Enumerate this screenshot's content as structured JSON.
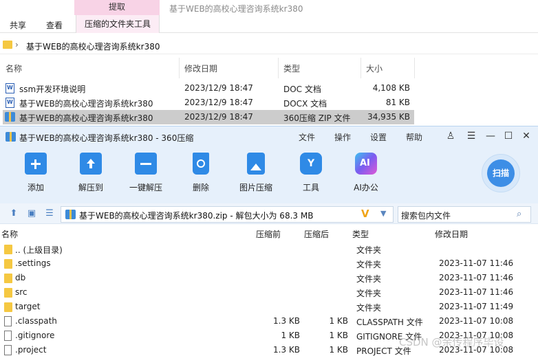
{
  "explorer": {
    "extract_tab": "提取",
    "window_title": "基于WEB的高校心理咨询系统kr380",
    "ribbon_tabs": [
      "共享",
      "查看",
      "压缩的文件夹工具"
    ],
    "address": "基于WEB的高校心理咨询系统kr380",
    "columns": [
      "名称",
      "修改日期",
      "类型",
      "大小"
    ],
    "files": [
      {
        "name": "ssm开发环境说明",
        "date": "2023/12/9 18:47",
        "type": "DOC 文档",
        "size": "4,108 KB",
        "icon": "word-doc-icon"
      },
      {
        "name": "基于WEB的高校心理咨询系统kr380",
        "date": "2023/12/9 18:47",
        "type": "DOCX 文档",
        "size": "81 KB",
        "icon": "word-doc-icon"
      },
      {
        "name": "基于WEB的高校心理咨询系统kr380",
        "date": "2023/12/9 18:47",
        "type": "360压缩 ZIP 文件",
        "size": "34,935 KB",
        "icon": "zip-archive-icon"
      }
    ]
  },
  "zipwin": {
    "title": "基于WEB的高校心理咨询系统kr380 - 360压缩",
    "menu": [
      "文件",
      "操作",
      "设置",
      "帮助"
    ],
    "tools": [
      {
        "label": "添加",
        "color": "#2f8ae6"
      },
      {
        "label": "解压到",
        "color": "#2f8ae6"
      },
      {
        "label": "一键解压",
        "color": "#2f8ae6"
      },
      {
        "label": "删除",
        "color": "#2f8ae6"
      },
      {
        "label": "图片压缩",
        "color": "#2f8ae6"
      },
      {
        "label": "工具",
        "color": "#2f8ae6"
      },
      {
        "label": "AI办公",
        "color": "#7b5cf0"
      }
    ],
    "scan_label": "扫描",
    "path": "基于WEB的高校心理咨询系统kr380.zip - 解包大小为 68.3 MB",
    "search_placeholder": "搜索包内文件",
    "columns": [
      "名称",
      "压缩前",
      "压缩后",
      "类型",
      "修改日期"
    ],
    "rows": [
      {
        "name": ".. (上级目录)",
        "before": "",
        "after": "",
        "type": "文件夹",
        "date": "",
        "kind": "folder"
      },
      {
        "name": ".settings",
        "before": "",
        "after": "",
        "type": "文件夹",
        "date": "2023-11-07 11:46",
        "kind": "folder"
      },
      {
        "name": "db",
        "before": "",
        "after": "",
        "type": "文件夹",
        "date": "2023-11-07 11:46",
        "kind": "folder"
      },
      {
        "name": "src",
        "before": "",
        "after": "",
        "type": "文件夹",
        "date": "2023-11-07 11:46",
        "kind": "folder"
      },
      {
        "name": "target",
        "before": "",
        "after": "",
        "type": "文件夹",
        "date": "2023-11-07 11:49",
        "kind": "folder"
      },
      {
        "name": ".classpath",
        "before": "1.3 KB",
        "after": "1 KB",
        "type": "CLASSPATH 文件",
        "date": "2023-11-07 10:08",
        "kind": "file"
      },
      {
        "name": ".gitignore",
        "before": "1 KB",
        "after": "1 KB",
        "type": "GITIGNORE 文件",
        "date": "2023-11-07 10:08",
        "kind": "file"
      },
      {
        "name": ".project",
        "before": "1.3 KB",
        "after": "1 KB",
        "type": "PROJECT 文件",
        "date": "2023-11-07 10:08",
        "kind": "file"
      }
    ]
  },
  "watermark": "CSDN @余传程序毕设"
}
